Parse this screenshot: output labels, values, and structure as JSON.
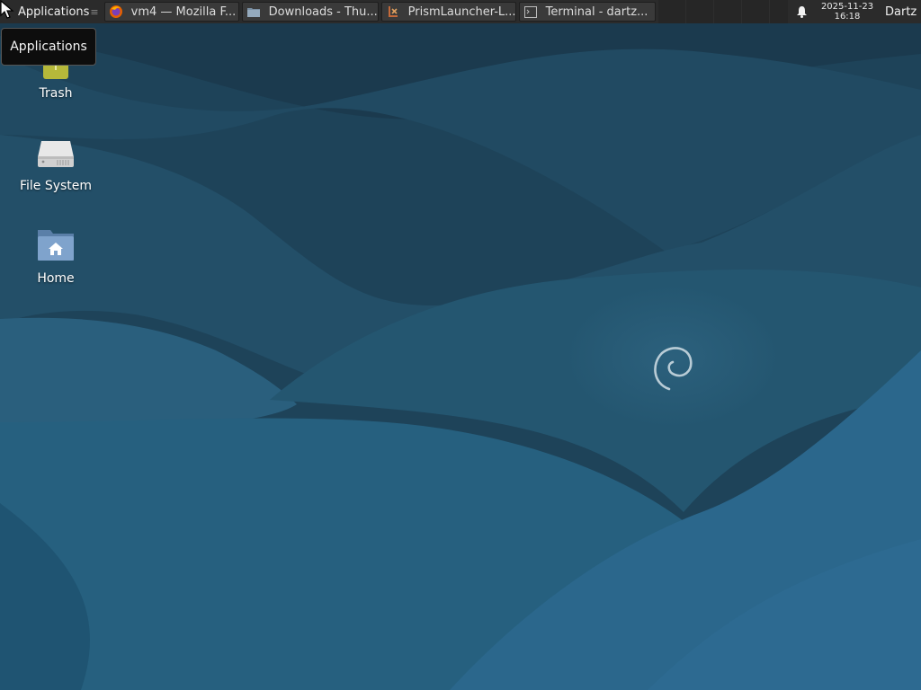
{
  "panel": {
    "applications_label": "Applications",
    "tasks": [
      {
        "label": "vm4 — Mozilla F...",
        "icon": "firefox-icon"
      },
      {
        "label": "Downloads - Thu...",
        "icon": "folder-icon"
      },
      {
        "label": "PrismLauncher-L...",
        "icon": "prism-launcher-icon"
      },
      {
        "label": "Terminal - dartz...",
        "icon": "terminal-icon"
      }
    ],
    "date": "2025-11-23",
    "time": "16:18",
    "user": "Dartz"
  },
  "tooltip": {
    "text": "Applications"
  },
  "desktop_icons": [
    {
      "label": "Trash",
      "icon": "trash-icon"
    },
    {
      "label": "File System",
      "icon": "drive-icon"
    },
    {
      "label": "Home",
      "icon": "home-folder-icon"
    }
  ],
  "colors": {
    "panel_bg": "#2b2b2b",
    "wallpaper_dark": "#1d3f54",
    "wallpaper_light": "#2c6a8e"
  }
}
